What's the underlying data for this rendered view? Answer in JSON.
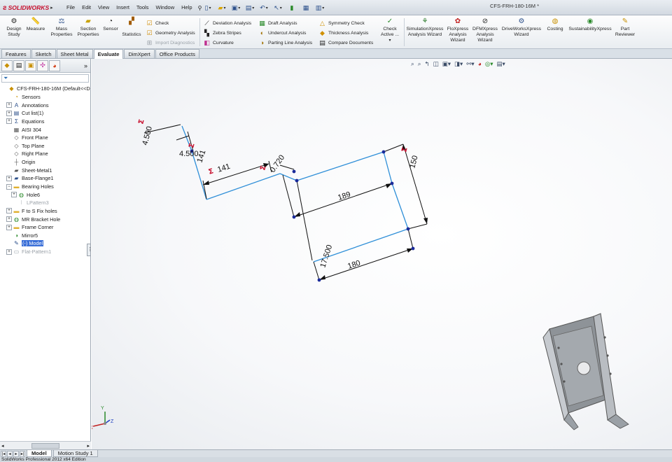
{
  "app": {
    "logo_text": "SOLIDWORKS",
    "doc_title": "CFS-FRH-180-16M *"
  },
  "menu": [
    "File",
    "Edit",
    "View",
    "Insert",
    "Tools",
    "Window",
    "Help"
  ],
  "ribbon": {
    "design_study": "Design Study",
    "measure": "Measure",
    "mass_properties": "Mass Properties",
    "section_properties": "Section Properties",
    "sensor": "Sensor",
    "statistics": "Statistics",
    "check": "Check",
    "geometry_analysis": "Geometry Analysis",
    "import_diagnostics": "Import Diagnostics",
    "deviation_analysis": "Deviation Analysis",
    "zebra_stripes": "Zebra Stripes",
    "curvature": "Curvature",
    "draft_analysis": "Draft Analysis",
    "undercut_analysis": "Undercut Analysis",
    "parting_line_analysis": "Parting Line Analysis",
    "symmetry_check": "Symmetry Check",
    "thickness_analysis": "Thickness Analysis",
    "compare_documents": "Compare Documents",
    "check_active": "Check Active ...",
    "simulationxpress": "SimulationXpress Analysis Wizard",
    "floxpress": "FloXpress Analysis Wizard",
    "dfmxpress": "DFMXpress Analysis Wizard",
    "driveworksxpress": "DriveWorksXpress Wizard",
    "costing": "Costing",
    "sustainabilityxpress": "SustainabilityXpress",
    "part_reviewer": "Part Reviewer"
  },
  "tabs": [
    "Features",
    "Sketch",
    "Sheet Metal",
    "Evaluate",
    "DimXpert",
    "Office Products"
  ],
  "active_tab": "Evaluate",
  "tree": [
    {
      "label": "CFS-FRH-180-16M  (Default<<D",
      "icon": "part-icon",
      "exp": "",
      "indent": 0
    },
    {
      "label": "Sensors",
      "icon": "sensor-icon",
      "exp": "",
      "indent": 1
    },
    {
      "label": "Annotations",
      "icon": "annotation-icon",
      "exp": "+",
      "indent": 1
    },
    {
      "label": "Cut list(1)",
      "icon": "cutlist-icon",
      "exp": "+",
      "indent": 1
    },
    {
      "label": "Equations",
      "icon": "equation-icon",
      "exp": "+",
      "indent": 1
    },
    {
      "label": "AISI 304",
      "icon": "material-icon",
      "exp": "",
      "indent": 1
    },
    {
      "label": "Front Plane",
      "icon": "plane-icon",
      "exp": "",
      "indent": 1
    },
    {
      "label": "Top Plane",
      "icon": "plane-icon",
      "exp": "",
      "indent": 1
    },
    {
      "label": "Right Plane",
      "icon": "plane-icon",
      "exp": "",
      "indent": 1
    },
    {
      "label": "Origin",
      "icon": "origin-icon",
      "exp": "",
      "indent": 1
    },
    {
      "label": "Sheet-Metal1",
      "icon": "sheetmetal-icon",
      "exp": "",
      "indent": 1
    },
    {
      "label": "Base-Flange1",
      "icon": "flange-icon",
      "exp": "+",
      "indent": 1
    },
    {
      "label": "Bearing Holes",
      "icon": "folder-icon",
      "exp": "−",
      "indent": 1
    },
    {
      "label": "Hole6",
      "icon": "hole-icon",
      "exp": "+",
      "indent": 2
    },
    {
      "label": "LPattern3",
      "icon": "pattern-icon",
      "exp": "",
      "indent": 2,
      "dim": true
    },
    {
      "label": "F to S Fix holes",
      "icon": "folder-icon",
      "exp": "+",
      "indent": 1
    },
    {
      "label": "MR Bracket Hole",
      "icon": "hole-icon",
      "exp": "+",
      "indent": 1
    },
    {
      "label": "Frame Corner",
      "icon": "folder-icon",
      "exp": "+",
      "indent": 1
    },
    {
      "label": "Mirror5",
      "icon": "mirror-icon",
      "exp": "",
      "indent": 1
    },
    {
      "label": "(-) Model",
      "icon": "sketch-icon",
      "exp": "",
      "indent": 1,
      "sel": true
    },
    {
      "label": "Flat-Pattern1",
      "icon": "flatpattern-icon",
      "exp": "+",
      "indent": 1,
      "dim": true
    }
  ],
  "dimensions": {
    "d1": "4.500",
    "d2": "4.500",
    "d3": "141",
    "d4": "141",
    "d5": "0.720",
    "d6": "150",
    "d7": "189",
    "d8": "17.500",
    "d9": "180"
  },
  "triad": {
    "x": "X",
    "y": "Y",
    "z": "Z"
  },
  "bottom_tabs": [
    "Model",
    "Motion Study 1"
  ],
  "status": "SolidWorks Professional 2012 x64 Edition",
  "colors": {
    "accent": "#c8102e",
    "sketch_blue": "#2f8fd8",
    "selection": "#3a6fd8"
  }
}
